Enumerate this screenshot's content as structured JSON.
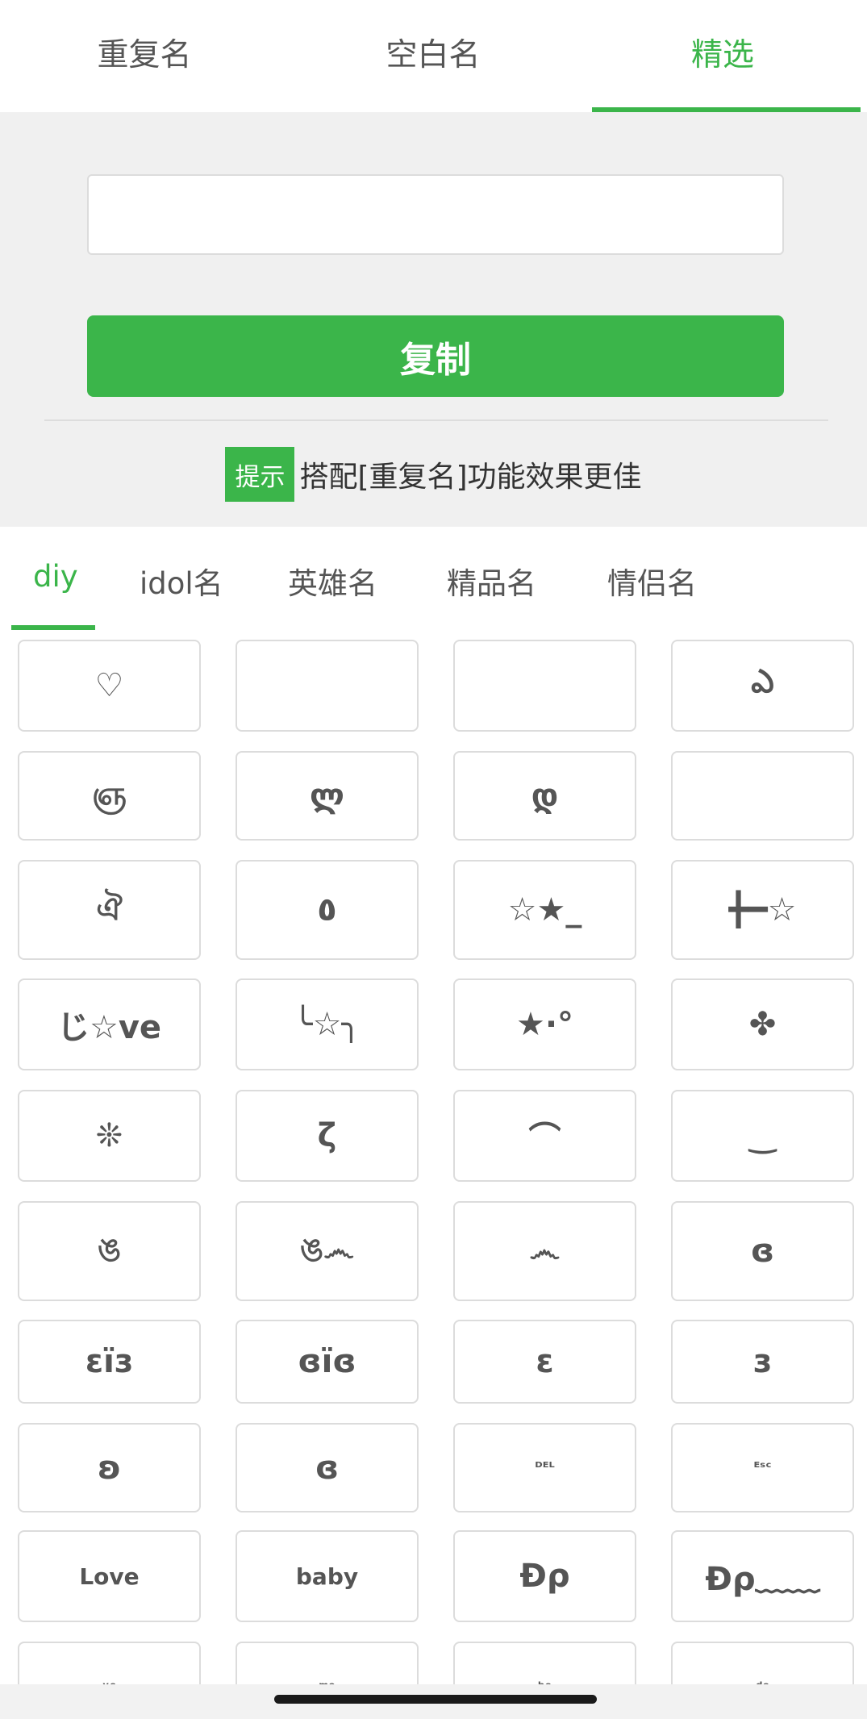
{
  "top_tabs": [
    {
      "label": "重复名"
    },
    {
      "label": "空白名"
    },
    {
      "label": "精选"
    }
  ],
  "active_top_tab": "精选",
  "input": {
    "value": "ᅟᅟ"
  },
  "copy_button": {
    "label": "复制"
  },
  "tip": {
    "badge": "提示",
    "text": "搭配[重复名]功能效果更佳"
  },
  "category_tabs": [
    {
      "label": "diy"
    },
    {
      "label": "idol名"
    },
    {
      "label": "英雄名"
    },
    {
      "label": "精品名"
    },
    {
      "label": "情侣名"
    }
  ],
  "active_category_tab": "diy",
  "symbols": [
    "♡",
    "ᅟ",
    "ᅟ",
    "ఎ",
    "ஞ",
    "ლ",
    "დ",
    "ᅟ",
    "ঐ",
    "٥",
    "☆★_",
    "╋━☆",
    "じ☆ve",
    "╰☆╮",
    "★·°",
    "✤",
    "❊",
    "ζ",
    "⌒",
    "‿",
    "ঙ",
    "ঙ෴",
    "෴",
    "ɞ",
    "ɛïз",
    "ɞïɞ",
    "ɛ",
    "з",
    "ʚ",
    "ɞ",
    "ᴰᴱᴸ",
    "ᴱˢᶜ",
    "Love",
    "baby",
    "Ðρ",
    "Ðρ﹏﹏",
    "ᵛᵉ",
    "ᵐᵉ",
    "ᵇᵉ",
    "ᵈᵉ"
  ],
  "colors": {
    "accent": "#3bb54a",
    "border": "#dcdcdc",
    "panel_bg": "#f0f0f0"
  }
}
